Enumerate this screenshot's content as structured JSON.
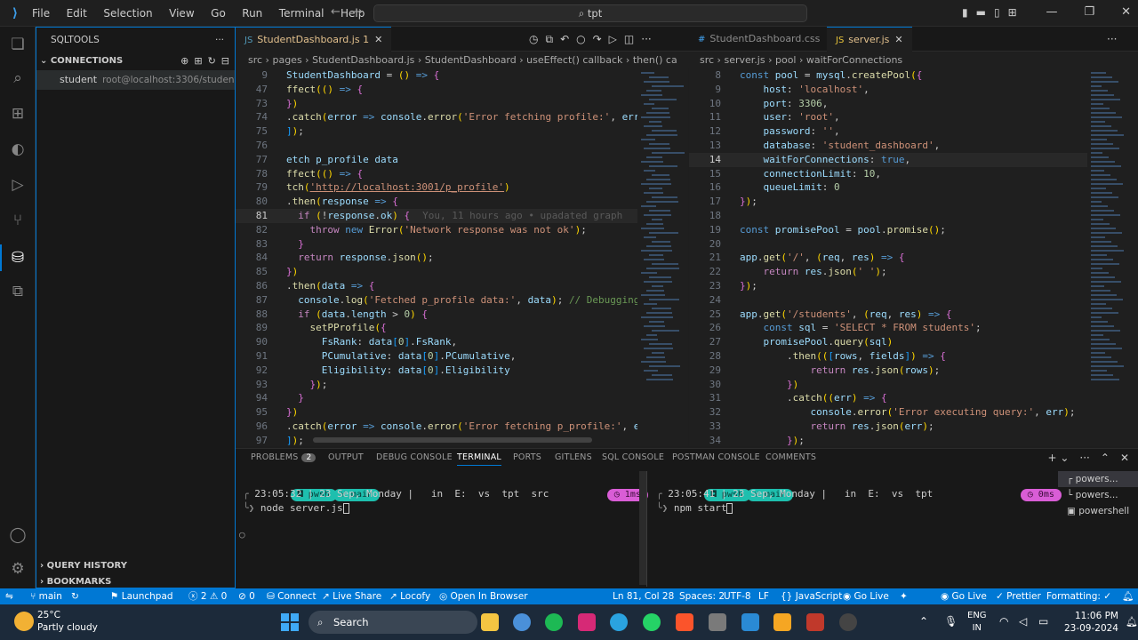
{
  "titlebar": {
    "menu": [
      "File",
      "Edit",
      "Selection",
      "View",
      "Go",
      "Run",
      "Terminal",
      "Help"
    ],
    "search": "tpt"
  },
  "sidebar": {
    "title": "SQLTOOLS",
    "connections_label": "CONNECTIONS",
    "connection_name": "student",
    "connection_detail": "root@localhost:3306/student_d...",
    "query_history": "QUERY HISTORY",
    "bookmarks": "BOOKMARKS"
  },
  "left_editor": {
    "tab_label": "StudentDashboard.js",
    "tab_badge": "1",
    "breadcrumb": [
      "src",
      "pages",
      "StudentDashboard.js",
      "StudentDashboard",
      "useEffect() callback",
      "then() ca"
    ],
    "lines": [
      {
        "n": "9",
        "t": "StudentDashboard = () => {"
      },
      {
        "n": "47",
        "t": "ffect(() => {"
      },
      {
        "n": "73",
        "t": "})"
      },
      {
        "n": "74",
        "t": ".catch(error => console.error('Error fetching profile:', erro"
      },
      {
        "n": "75",
        "t": "]);"
      },
      {
        "n": "76",
        "t": ""
      },
      {
        "n": "77",
        "t": "etch p_profile data"
      },
      {
        "n": "78",
        "t": "ffect(() => {"
      },
      {
        "n": "79",
        "t": "tch('http://localhost:3001/p_profile')"
      },
      {
        "n": "80",
        "t": ".then(response => {"
      },
      {
        "n": "81",
        "t": "  if (!response.ok) {",
        "ghost": "You, 11 hours ago • upadated graph"
      },
      {
        "n": "82",
        "t": "    throw new Error('Network response was not ok');"
      },
      {
        "n": "83",
        "t": "  }"
      },
      {
        "n": "84",
        "t": "  return response.json();"
      },
      {
        "n": "85",
        "t": "})"
      },
      {
        "n": "86",
        "t": ".then(data => {"
      },
      {
        "n": "87",
        "t": "  console.log('Fetched p_profile data:', data); // Debugging"
      },
      {
        "n": "88",
        "t": "  if (data.length > 0) {"
      },
      {
        "n": "89",
        "t": "    setPProfile({"
      },
      {
        "n": "90",
        "t": "      FsRank: data[0].FsRank,"
      },
      {
        "n": "91",
        "t": "      PCumulative: data[0].PCumulative,"
      },
      {
        "n": "92",
        "t": "      Eligibility: data[0].Eligibility"
      },
      {
        "n": "93",
        "t": "    });"
      },
      {
        "n": "94",
        "t": "  }"
      },
      {
        "n": "95",
        "t": "})"
      },
      {
        "n": "96",
        "t": ".catch(error => console.error('Error fetching p_profile:', er"
      },
      {
        "n": "97",
        "t": "]);"
      }
    ]
  },
  "right_editor": {
    "tabs": [
      "StudentDashboard.css",
      "server.js"
    ],
    "breadcrumb": [
      "src",
      "server.js",
      "pool",
      "waitForConnections"
    ],
    "lines": [
      {
        "n": "8",
        "t": "const pool = mysql.createPool({"
      },
      {
        "n": "9",
        "t": "    host: 'localhost',"
      },
      {
        "n": "10",
        "t": "    port: 3306,"
      },
      {
        "n": "11",
        "t": "    user: 'root',"
      },
      {
        "n": "12",
        "t": "    password: '',"
      },
      {
        "n": "13",
        "t": "    database: 'student_dashboard',"
      },
      {
        "n": "14",
        "t": "    waitForConnections: true,"
      },
      {
        "n": "15",
        "t": "    connectionLimit: 10,"
      },
      {
        "n": "16",
        "t": "    queueLimit: 0"
      },
      {
        "n": "17",
        "t": "});"
      },
      {
        "n": "18",
        "t": ""
      },
      {
        "n": "19",
        "t": "const promisePool = pool.promise();"
      },
      {
        "n": "20",
        "t": ""
      },
      {
        "n": "21",
        "t": "app.get('/', (req, res) => {"
      },
      {
        "n": "22",
        "t": "    return res.json(' ');"
      },
      {
        "n": "23",
        "t": "});"
      },
      {
        "n": "24",
        "t": ""
      },
      {
        "n": "25",
        "t": "app.get('/students', (req, res) => {"
      },
      {
        "n": "26",
        "t": "    const sql = 'SELECT * FROM students';"
      },
      {
        "n": "27",
        "t": "    promisePool.query(sql)"
      },
      {
        "n": "28",
        "t": "        .then(([rows, fields]) => {"
      },
      {
        "n": "29",
        "t": "            return res.json(rows);"
      },
      {
        "n": "30",
        "t": "        })"
      },
      {
        "n": "31",
        "t": "        .catch((err) => {"
      },
      {
        "n": "32",
        "t": "            console.error('Error executing query:', err);"
      },
      {
        "n": "33",
        "t": "            return res.json(err);"
      },
      {
        "n": "34",
        "t": "        });"
      }
    ]
  },
  "panel": {
    "tabs": [
      "PROBLEMS",
      "OUTPUT",
      "DEBUG CONSOLE",
      "TERMINAL",
      "PORTS",
      "GITLENS",
      "SQL CONSOLE",
      "POSTMAN CONSOLE",
      "COMMENTS"
    ],
    "problems_count": "2",
    "term1": {
      "shell": "pwsh",
      "branch": "main",
      "time_badge": "1ms",
      "prompt": "23:05:32 | 23 Sep, Monday |   in  E:  vs  tpt  src",
      "command": "node server.js"
    },
    "term2": {
      "shell": "pwsh",
      "branch": "main",
      "time_badge": "0ms",
      "prompt": "23:05:41 | 23 Sep, Monday |   in  E:  vs  tpt",
      "command": "npm start"
    },
    "terminal_list": [
      "powers...",
      "powers...",
      "powershell"
    ]
  },
  "statusbar": {
    "branch": "main",
    "launchpad": "Launchpad",
    "errors": "2",
    "warnings": "0",
    "ports": "0",
    "connect": "Connect",
    "live_share": "Live Share",
    "locofy": "Locofy",
    "open_browser": "Open In Browser",
    "position": "Ln 81, Col 28",
    "spaces": "Spaces: 2",
    "encoding": "UTF-8",
    "eol": "LF",
    "language": "JavaScript",
    "golive1": "Go Live",
    "golive2": "Go Live",
    "prettier": "Prettier",
    "formatting": "Formatting: ✓"
  },
  "taskbar": {
    "temp": "25°C",
    "weather": "Partly cloudy",
    "search": "Search",
    "lang1": "ENG",
    "lang2": "IN",
    "time": "11:06 PM",
    "date": "23-09-2024"
  }
}
